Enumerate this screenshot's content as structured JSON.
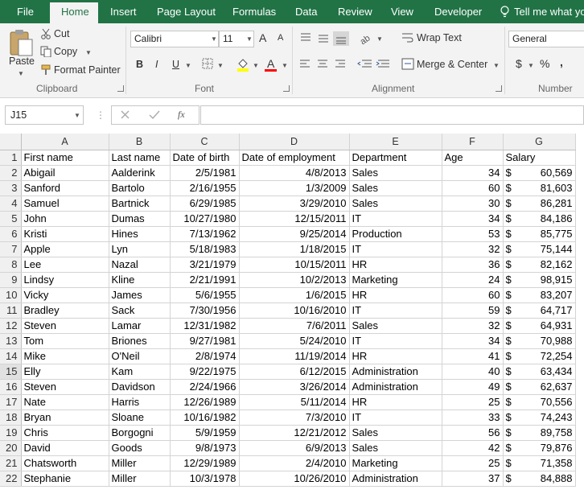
{
  "tabs": [
    "File",
    "Home",
    "Insert",
    "Page Layout",
    "Formulas",
    "Data",
    "Review",
    "View",
    "Developer",
    "Tell me what you"
  ],
  "ribbon": {
    "clipboard": {
      "paste": "Paste",
      "cut": "Cut",
      "copy": "Copy",
      "format_painter": "Format Painter",
      "label": "Clipboard"
    },
    "font": {
      "name": "Calibri",
      "size": "11",
      "bold": "B",
      "italic": "I",
      "underline": "U",
      "grow": "A",
      "shrink": "A",
      "font_color": "A",
      "label": "Font"
    },
    "alignment": {
      "wrap_text": "Wrap Text",
      "merge_center": "Merge & Center",
      "label": "Alignment"
    },
    "number": {
      "format": "General",
      "currency": "$",
      "percent": "%",
      "comma": ",",
      "label": "Number"
    }
  },
  "formula_bar": {
    "name_box": "J15",
    "fx": "fx",
    "value": ""
  },
  "columns": [
    "A",
    "B",
    "C",
    "D",
    "E",
    "F",
    "G"
  ],
  "headers": [
    "First name",
    "Last name",
    "Date of birth",
    "Date of employment",
    "Department",
    "Age",
    "Salary"
  ],
  "rows": [
    [
      "Abigail",
      "Aalderink",
      "2/5/1981",
      "4/8/2013",
      "Sales",
      "34",
      "60,569"
    ],
    [
      "Sanford",
      "Bartolo",
      "2/16/1955",
      "1/3/2009",
      "Sales",
      "60",
      "81,603"
    ],
    [
      "Samuel",
      "Bartnick",
      "6/29/1985",
      "3/29/2010",
      "Sales",
      "30",
      "86,281"
    ],
    [
      "John",
      "Dumas",
      "10/27/1980",
      "12/15/2011",
      "IT",
      "34",
      "84,186"
    ],
    [
      "Kristi",
      "Hines",
      "7/13/1962",
      "9/25/2014",
      "Production",
      "53",
      "85,775"
    ],
    [
      "Apple",
      "Lyn",
      "5/18/1983",
      "1/18/2015",
      "IT",
      "32",
      "75,144"
    ],
    [
      "Lee",
      "Nazal",
      "3/21/1979",
      "10/15/2011",
      "HR",
      "36",
      "82,162"
    ],
    [
      "Lindsy",
      "Kline",
      "2/21/1991",
      "10/2/2013",
      "Marketing",
      "24",
      "98,915"
    ],
    [
      "Vicky",
      "James",
      "5/6/1955",
      "1/6/2015",
      "HR",
      "60",
      "83,207"
    ],
    [
      "Bradley",
      "Sack",
      "7/30/1956",
      "10/16/2010",
      "IT",
      "59",
      "64,717"
    ],
    [
      "Steven",
      "Lamar",
      "12/31/1982",
      "7/6/2011",
      "Sales",
      "32",
      "64,931"
    ],
    [
      "Tom",
      "Briones",
      "9/27/1981",
      "5/24/2010",
      "IT",
      "34",
      "70,988"
    ],
    [
      "Mike",
      "O'Neil",
      "2/8/1974",
      "11/19/2014",
      "HR",
      "41",
      "72,254"
    ],
    [
      "Elly",
      "Kam",
      "9/22/1975",
      "6/12/2015",
      "Administration",
      "40",
      "63,434"
    ],
    [
      "Steven",
      "Davidson",
      "2/24/1966",
      "3/26/2014",
      "Administration",
      "49",
      "62,637"
    ],
    [
      "Nate",
      "Harris",
      "12/26/1989",
      "5/11/2014",
      "HR",
      "25",
      "70,556"
    ],
    [
      "Bryan",
      "Sloane",
      "10/16/1982",
      "7/3/2010",
      "IT",
      "33",
      "74,243"
    ],
    [
      "Chris",
      "Borgogni",
      "5/9/1959",
      "12/21/2012",
      "Sales",
      "56",
      "89,758"
    ],
    [
      "David",
      "Goods",
      "9/8/1973",
      "6/9/2013",
      "Sales",
      "42",
      "79,876"
    ],
    [
      "Chatsworth",
      "Miller",
      "12/29/1989",
      "2/4/2010",
      "Marketing",
      "25",
      "71,358"
    ],
    [
      "Stephanie",
      "Miller",
      "10/3/1978",
      "10/26/2010",
      "Administration",
      "37",
      "84,888"
    ]
  ],
  "currency_symbol": "$",
  "colors": {
    "excel_green": "#217346",
    "grid_line": "#d4d4d4",
    "header_bg": "#f0f0f0"
  }
}
